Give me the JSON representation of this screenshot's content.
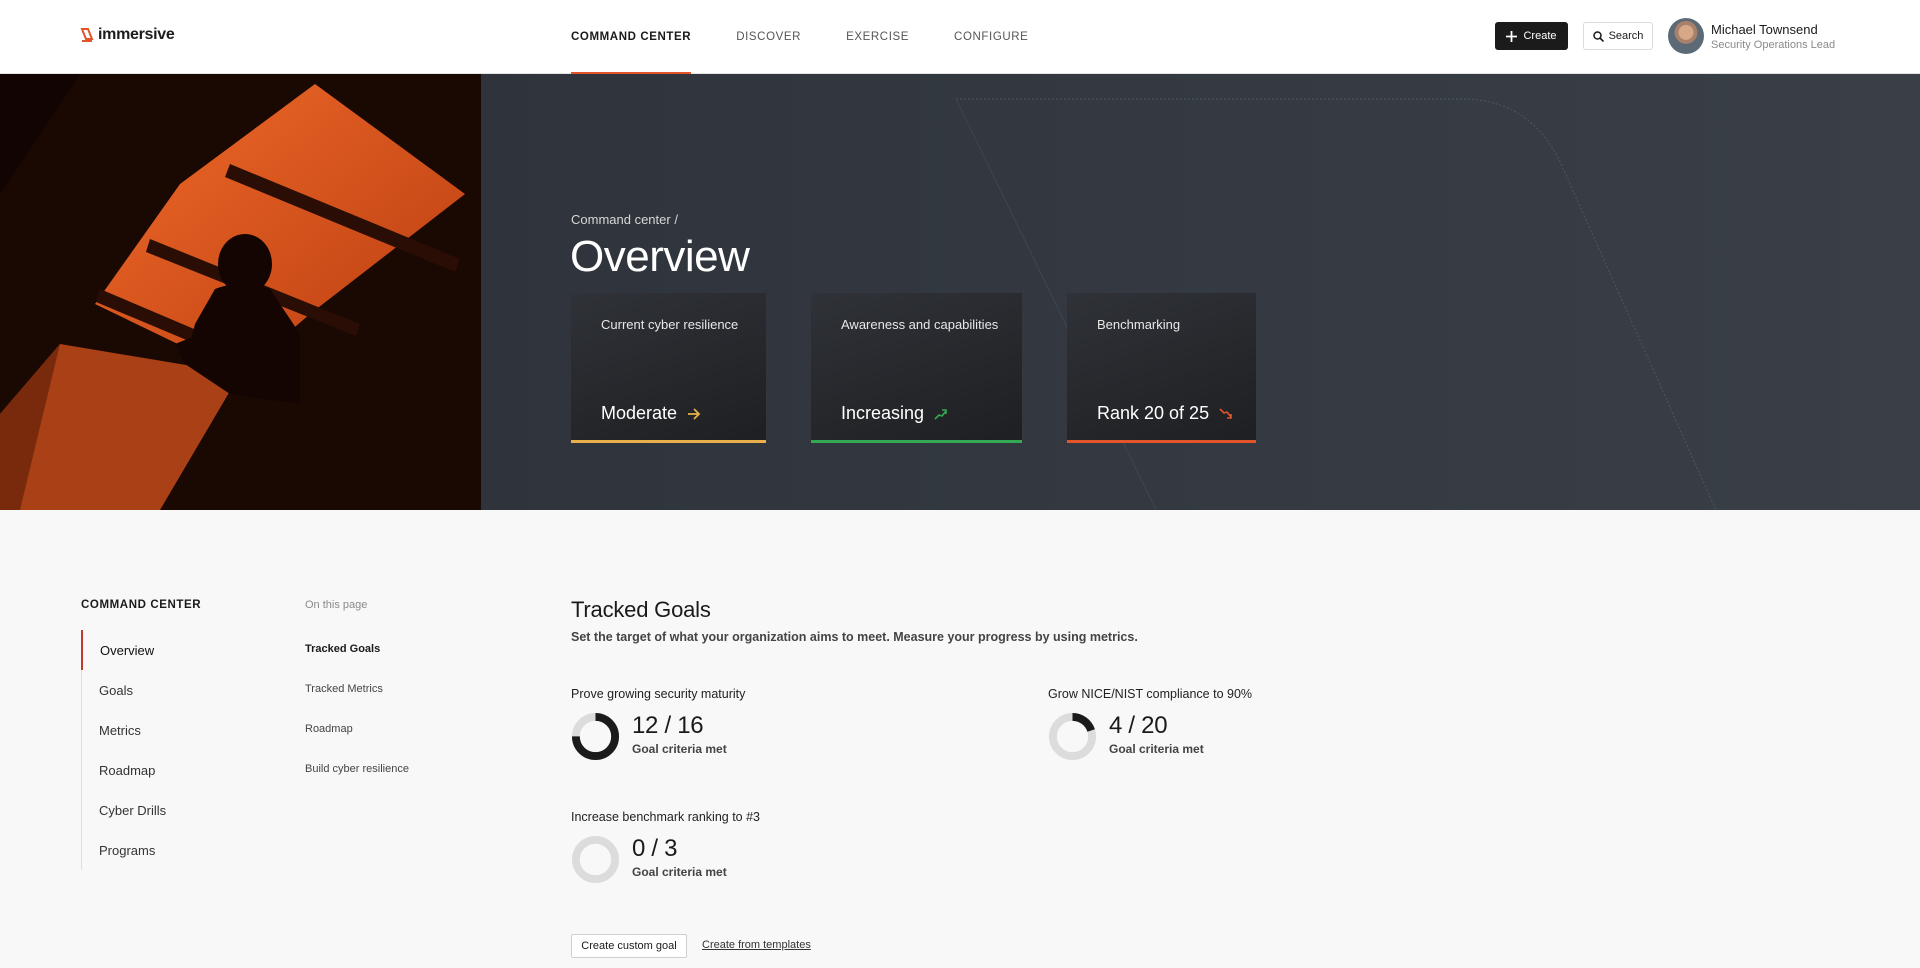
{
  "brand": {
    "name": "immersive",
    "accent": "#e2542a"
  },
  "header": {
    "nav": [
      {
        "label": "COMMAND CENTER",
        "active": true
      },
      {
        "label": "DISCOVER",
        "active": false
      },
      {
        "label": "EXERCISE",
        "active": false
      },
      {
        "label": "CONFIGURE",
        "active": false
      }
    ],
    "create_label": "Create",
    "search_label": "Search",
    "user": {
      "name": "Michael Townsend",
      "role": "Security Operations Lead"
    }
  },
  "hero": {
    "breadcrumb": "Command center  /",
    "title": "Overview",
    "cards": [
      {
        "label": "Current cyber resilience",
        "value": "Moderate",
        "trend_icon": "arrow-right-icon",
        "color": "#e8b04a"
      },
      {
        "label": "Awareness and capabilities",
        "value": "Increasing",
        "trend_icon": "arrow-up-right-icon",
        "color": "#34a853"
      },
      {
        "label": "Benchmarking",
        "value": "Rank 20 of 25",
        "trend_icon": "arrow-down-right-icon",
        "color": "#e2542a"
      }
    ]
  },
  "sidebar": {
    "title": "COMMAND CENTER",
    "items": [
      {
        "label": "Overview",
        "active": true
      },
      {
        "label": "Goals",
        "active": false
      },
      {
        "label": "Metrics",
        "active": false
      },
      {
        "label": "Roadmap",
        "active": false
      },
      {
        "label": "Cyber Drills",
        "active": false
      },
      {
        "label": "Programs",
        "active": false
      }
    ]
  },
  "on_this_page": {
    "title": "On this page",
    "items": [
      {
        "label": "Tracked Goals",
        "active": true
      },
      {
        "label": "Tracked Metrics",
        "active": false
      },
      {
        "label": "Roadmap",
        "active": false
      },
      {
        "label": "Build cyber resilience",
        "active": false
      }
    ]
  },
  "tracked_goals": {
    "title": "Tracked Goals",
    "subtitle": "Set the target of what your organization aims to meet. Measure your progress by using metrics.",
    "goals": [
      {
        "label": "Prove growing security maturity",
        "met": 12,
        "total": 16,
        "count": "12 / 16",
        "caption": "Goal criteria met"
      },
      {
        "label": "Grow NICE/NIST compliance to 90%",
        "met": 4,
        "total": 20,
        "count": "4 / 20",
        "caption": "Goal criteria met"
      },
      {
        "label": "Increase benchmark ranking to #3",
        "met": 0,
        "total": 3,
        "count": "0 / 3",
        "caption": "Goal criteria met"
      }
    ],
    "create_custom_label": "Create custom goal",
    "create_templates_label": "Create from templates"
  }
}
